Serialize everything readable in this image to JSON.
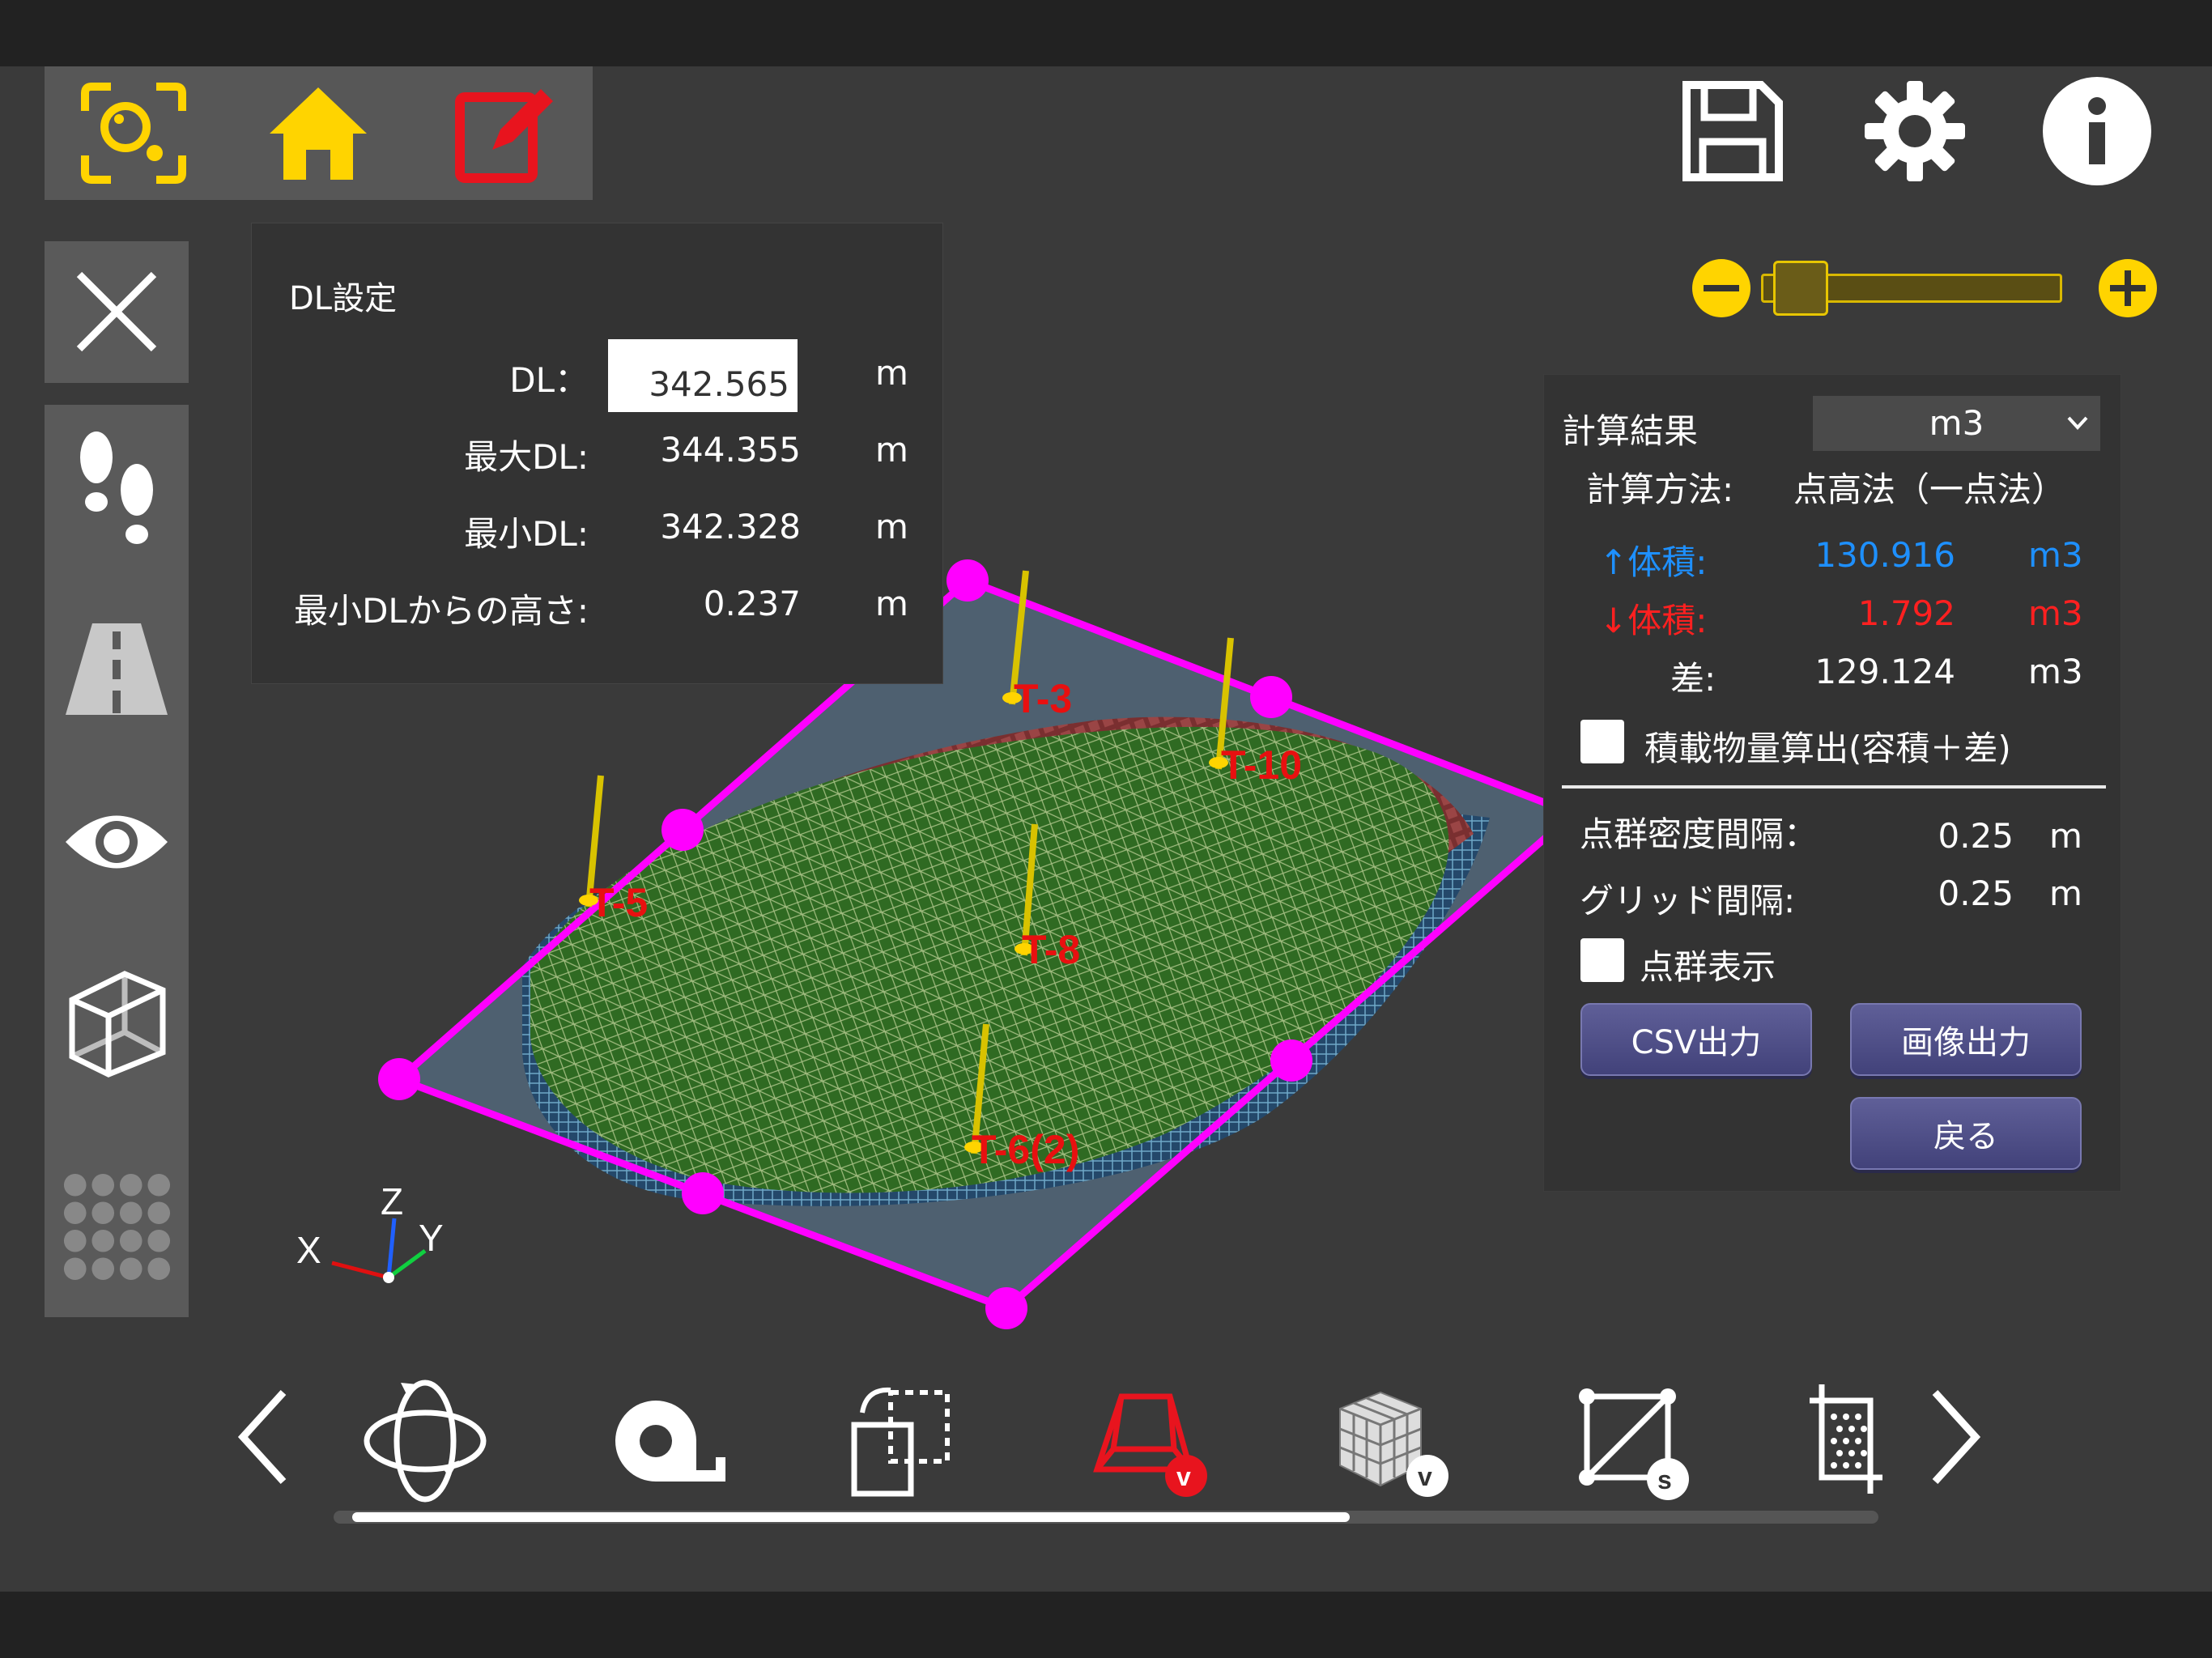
{
  "dl_panel": {
    "title": "DL設定",
    "dl_label": "DL：",
    "dl_value": "342.565",
    "max_label": "最大DL:",
    "max_value": "344.355",
    "min_label": "最小DL:",
    "min_value": "342.328",
    "height_label": "最小DLからの高さ:",
    "height_value": "0.237",
    "unit": "m"
  },
  "results": {
    "title": "計算結果",
    "unit_select": "m3",
    "method_label": "計算方法:",
    "method_value": "点高法（一点法）",
    "cut_label": "↑体積:",
    "cut_value": "130.916",
    "fill_label": "↓体積:",
    "fill_value": "1.792",
    "diff_label": "差:",
    "diff_value": "129.124",
    "volume_unit": "m3",
    "load_calc_label": "積載物量算出(容積＋差)",
    "density_label": "点群密度間隔：",
    "density_value": "0.25",
    "grid_label": "グリッド間隔:",
    "grid_value": "0.25",
    "length_unit": "m",
    "show_points_label": "点群表示",
    "csv_button": "CSV出力",
    "image_button": "画像出力",
    "back_button": "戻る"
  },
  "markers": [
    "T-3",
    "T-10",
    "T-5",
    "T-8",
    "T-6(2)"
  ],
  "axes": {
    "x": "X",
    "y": "Y",
    "z": "Z"
  },
  "colors": {
    "accent_yellow": "#ffd400",
    "edit_red": "#e8141e",
    "boundary_magenta": "#ff00ff",
    "cut_blue": "#1e90ff",
    "fill_red": "#ff2020",
    "button_purple": "#4f4f88"
  },
  "icons": {
    "top_left": [
      "scan-icon",
      "home-icon",
      "edit-icon"
    ],
    "top_right": [
      "save-icon",
      "gear-icon",
      "info-icon"
    ],
    "sidebar": [
      "close-icon",
      "footprints-icon",
      "road-icon",
      "eye-icon",
      "cube-icon",
      "grid-dots-icon"
    ],
    "toolbar": [
      "prev-icon",
      "rotate-icon",
      "measure-tape-icon",
      "transform-icon",
      "volume-v-icon",
      "blocks-v-icon",
      "boundary-s-icon",
      "crop-points-icon",
      "next-icon"
    ]
  },
  "zoom": {
    "level": 0.05
  }
}
